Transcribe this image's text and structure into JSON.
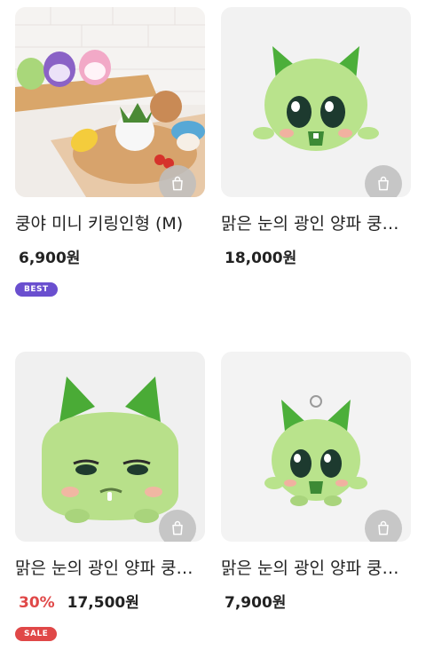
{
  "products": [
    {
      "name": "쿵야 미니 키링인형 (M)",
      "price": "6,900원",
      "discount": "",
      "badge": "BEST",
      "badge_color": "#6a4fcf"
    },
    {
      "name": "맑은 눈의 광인 양파 쿵야 말랑 쿠션",
      "price": "18,000원",
      "discount": "",
      "badge": "",
      "badge_color": ""
    },
    {
      "name": "맑은 눈의 광인 양파 쿵야 인형",
      "price": "17,500원",
      "discount": "30%",
      "badge": "SALE",
      "badge_color": "#e04848"
    },
    {
      "name": "맑은 눈의 광인 양파 쿵야 키링",
      "price": "7,900원",
      "discount": "",
      "badge": "",
      "badge_color": ""
    }
  ],
  "icons": {
    "cart": "shopping-bag-icon"
  }
}
